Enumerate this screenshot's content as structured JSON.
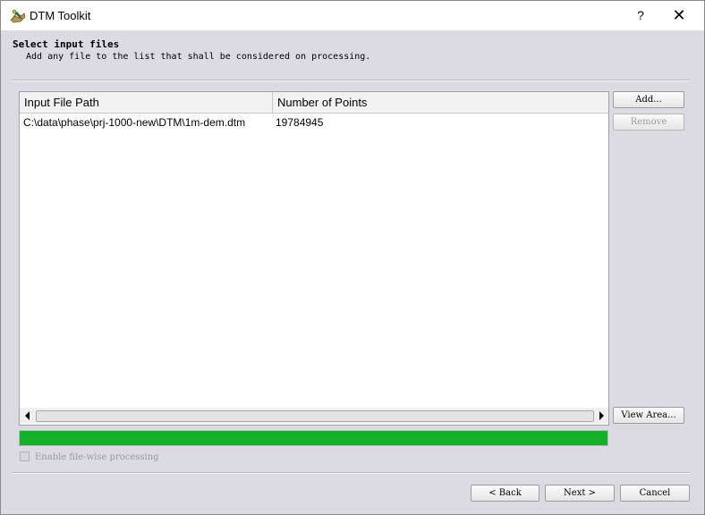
{
  "window": {
    "title": "DTM Toolkit",
    "help_label": "?",
    "close_label": "✕",
    "icon": "dtm-toolkit-app-icon"
  },
  "header": {
    "title": "Select input files",
    "subtitle": "Add any file to the list that shall be considered on processing."
  },
  "table": {
    "columns": [
      "Input File Path",
      "Number of Points"
    ],
    "rows": [
      {
        "path": "C:\\data\\phase\\prj-1000-new\\DTM\\1m-dem.dtm",
        "points": "19784945"
      }
    ]
  },
  "side_buttons": {
    "add": "Add...",
    "remove": "Remove",
    "view_area": "View Area..."
  },
  "progress": {
    "value_percent": 100,
    "color": "#13b128"
  },
  "options": {
    "filewise_label": "Enable file-wise processing",
    "filewise_checked": false
  },
  "footer": {
    "back": "< Back",
    "next": "Next >",
    "cancel": "Cancel"
  }
}
